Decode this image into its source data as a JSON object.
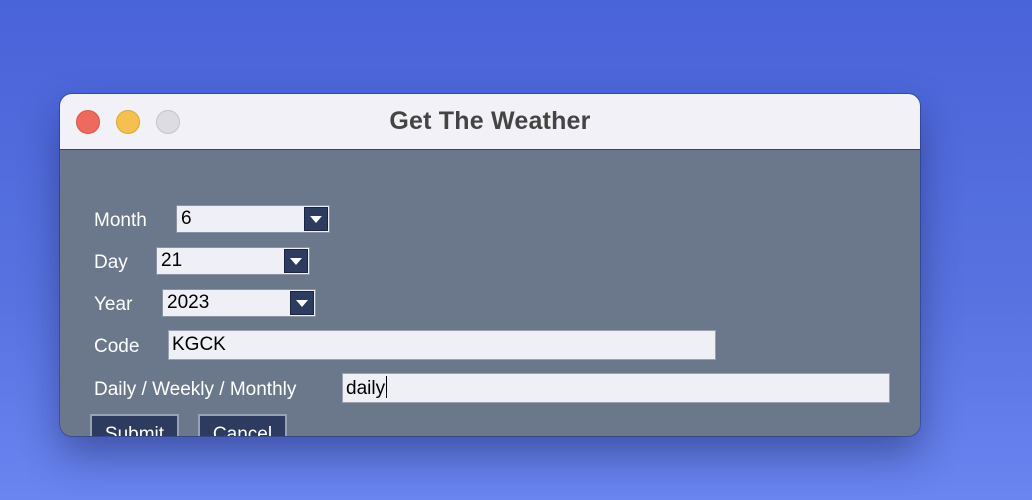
{
  "window": {
    "title": "Get The Weather"
  },
  "form": {
    "month": {
      "label": "Month",
      "value": "6"
    },
    "day": {
      "label": "Day",
      "value": "21"
    },
    "year": {
      "label": "Year",
      "value": "2023"
    },
    "code": {
      "label": "Code",
      "value": "KGCK"
    },
    "period": {
      "label": "Daily / Weekly / Monthly",
      "value": "daily"
    }
  },
  "buttons": {
    "submit": "Submit",
    "cancel": "Cancel"
  },
  "colors": {
    "desktop": "#4a63d9",
    "window_body": "#6b788c",
    "titlebar": "#f1f1f7",
    "button": "#2c3b5e",
    "close": "#ee6a5e",
    "minimize": "#f5c04f",
    "zoom": "#dcdce2"
  }
}
